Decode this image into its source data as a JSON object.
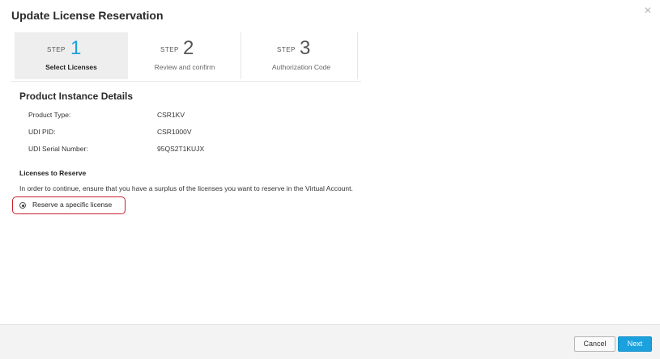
{
  "dialog": {
    "title": "Update License Reservation",
    "close_icon": "close-icon"
  },
  "steps": [
    {
      "word": "STEP",
      "number": "1",
      "label": "Select Licenses",
      "active": true
    },
    {
      "word": "STEP",
      "number": "2",
      "label": "Review and confirm",
      "active": false
    },
    {
      "word": "STEP",
      "number": "3",
      "label": "Authorization Code",
      "active": false
    }
  ],
  "details": {
    "title": "Product Instance Details",
    "rows": [
      {
        "label": "Product Type:",
        "value": "CSR1KV"
      },
      {
        "label": "UDI PID:",
        "value": "CSR1000V"
      },
      {
        "label": "UDI Serial Number:",
        "value": "95QS2T1KUJX"
      }
    ]
  },
  "reserve": {
    "title": "Licenses to Reserve",
    "info": "In order to continue, ensure that you have a surplus of the licenses you want to reserve in the Virtual Account.",
    "option_label": "Reserve a specific license",
    "option_selected": true,
    "highlight_color": "#c8202f"
  },
  "footer": {
    "cancel_label": "Cancel",
    "next_label": "Next"
  },
  "colors": {
    "accent": "#1ba1dd",
    "active_step_bg": "#eeeeee"
  }
}
